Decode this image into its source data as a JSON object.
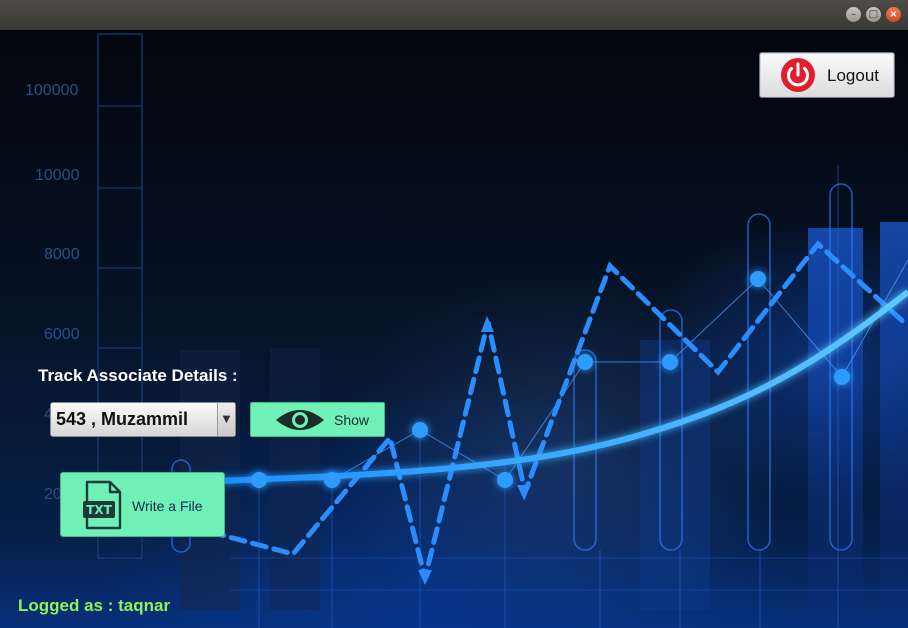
{
  "window": {
    "minimize_icon": "minimize-icon",
    "maximize_icon": "maximize-icon",
    "close_icon": "close-icon"
  },
  "background": {
    "y_axis_labels": [
      "100000",
      "10000",
      "8000",
      "6000",
      "4",
      "20"
    ]
  },
  "logout": {
    "label": "Logout",
    "icon": "power-icon",
    "icon_color": "#e01f2e"
  },
  "track": {
    "label": "Track Associate Details :",
    "selected_associate": "543 , Muzammil",
    "show_label": "Show",
    "show_icon": "eye-icon",
    "write_file_label": "Write a File",
    "write_file_icon": "txt-file-icon",
    "write_file_icon_text": "TXT"
  },
  "footer": {
    "logged_as": "Logged as  :  taqnar"
  },
  "colors": {
    "button_green": "#6ff0b7",
    "logged_as_text": "#8ff25a",
    "chart_blue": "#1e90ff"
  }
}
